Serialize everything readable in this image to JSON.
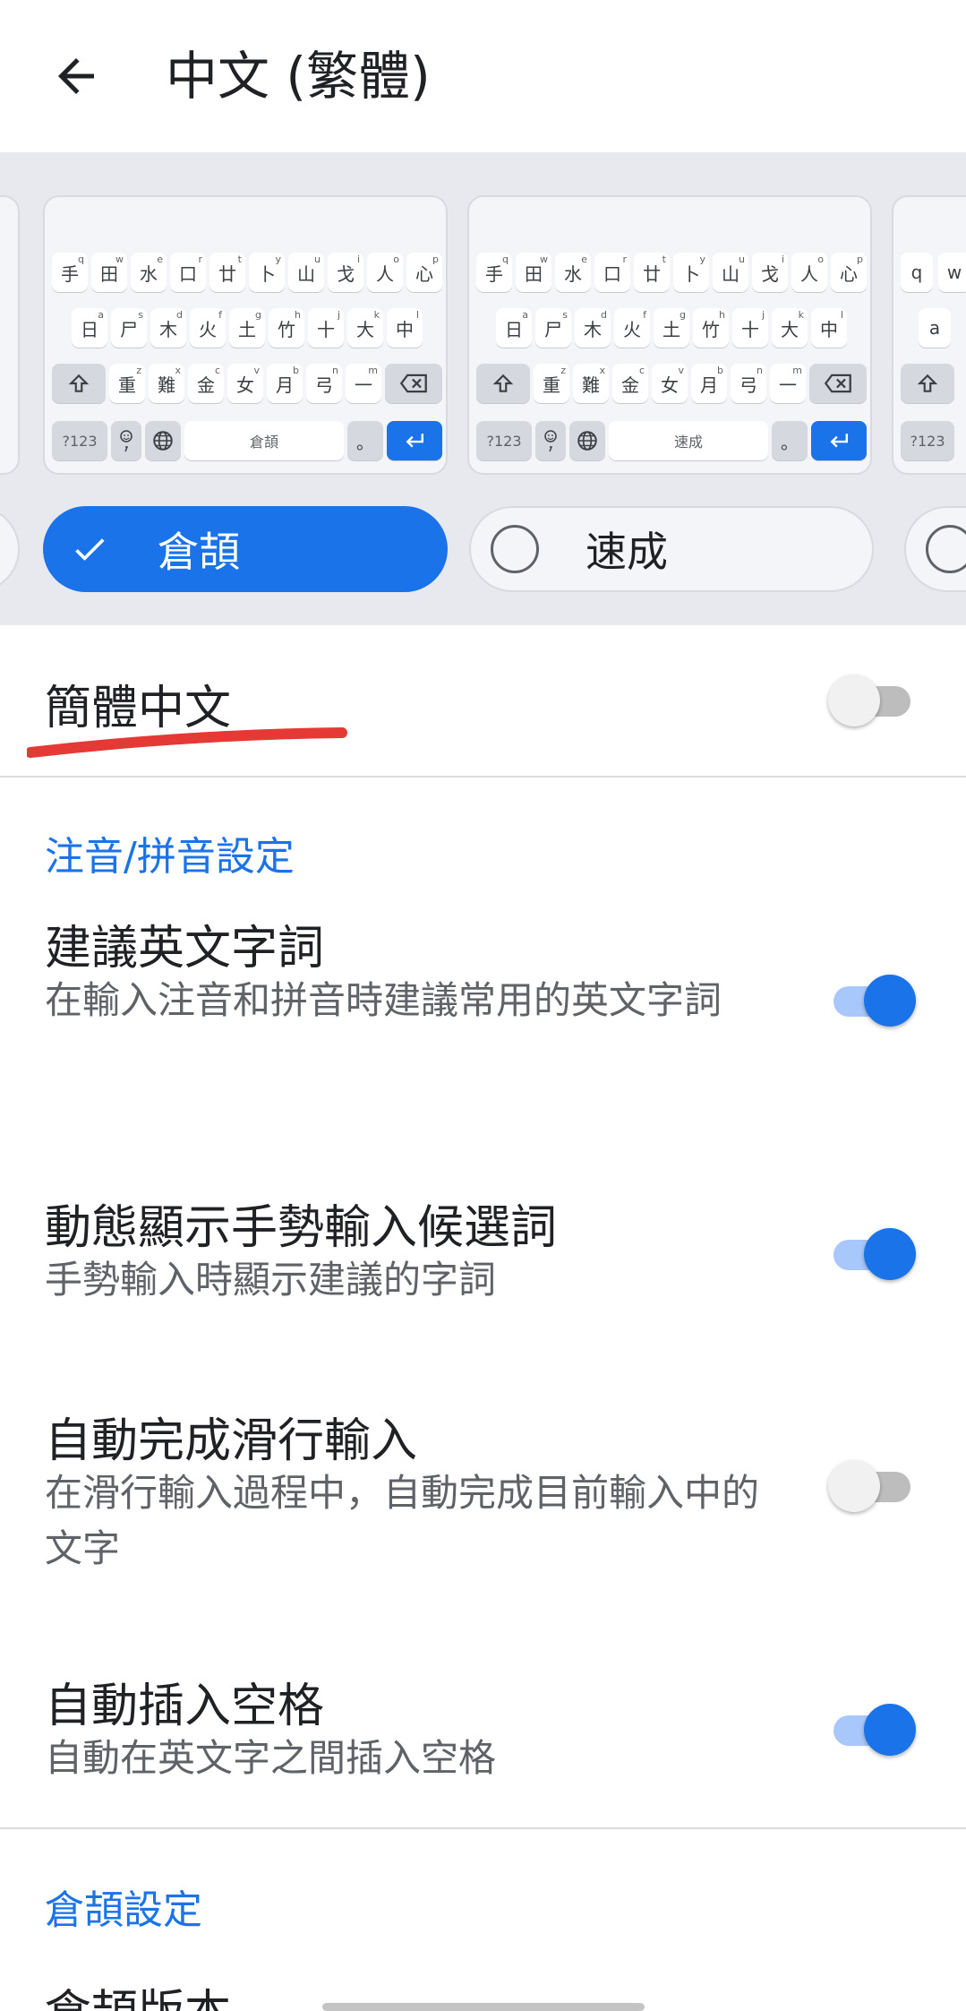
{
  "header": {
    "title": "中文 (繁體)"
  },
  "layouts": {
    "cards": [
      {
        "rows": [
          [
            [
              "手",
              "q"
            ],
            [
              "田",
              "w"
            ],
            [
              "水",
              "e"
            ],
            [
              "口",
              "r"
            ],
            [
              "廿",
              "t"
            ],
            [
              "卜",
              "y"
            ],
            [
              "山",
              "u"
            ],
            [
              "戈",
              "i"
            ],
            [
              "人",
              "o"
            ],
            [
              "心",
              "p"
            ]
          ],
          [
            [
              "日",
              "a"
            ],
            [
              "尸",
              "s"
            ],
            [
              "木",
              "d"
            ],
            [
              "火",
              "f"
            ],
            [
              "土",
              "g"
            ],
            [
              "竹",
              "h"
            ],
            [
              "十",
              "j"
            ],
            [
              "大",
              "k"
            ],
            [
              "中",
              "l"
            ]
          ],
          [
            [
              "重",
              "z"
            ],
            [
              "難",
              "x"
            ],
            [
              "金",
              "c"
            ],
            [
              "女",
              "v"
            ],
            [
              "月",
              "b"
            ],
            [
              "弓",
              "n"
            ],
            [
              "一",
              "m"
            ]
          ]
        ],
        "symbols_key": "?123",
        "space_label": "倉頡",
        "period": "。"
      },
      {
        "rows": [
          [
            [
              "手",
              "q"
            ],
            [
              "田",
              "w"
            ],
            [
              "水",
              "e"
            ],
            [
              "口",
              "r"
            ],
            [
              "廿",
              "t"
            ],
            [
              "卜",
              "y"
            ],
            [
              "山",
              "u"
            ],
            [
              "戈",
              "i"
            ],
            [
              "人",
              "o"
            ],
            [
              "心",
              "p"
            ]
          ],
          [
            [
              "日",
              "a"
            ],
            [
              "尸",
              "s"
            ],
            [
              "木",
              "d"
            ],
            [
              "火",
              "f"
            ],
            [
              "土",
              "g"
            ],
            [
              "竹",
              "h"
            ],
            [
              "十",
              "j"
            ],
            [
              "大",
              "k"
            ],
            [
              "中",
              "l"
            ]
          ],
          [
            [
              "重",
              "z"
            ],
            [
              "難",
              "x"
            ],
            [
              "金",
              "c"
            ],
            [
              "女",
              "v"
            ],
            [
              "月",
              "b"
            ],
            [
              "弓",
              "n"
            ],
            [
              "一",
              "m"
            ]
          ]
        ],
        "symbols_key": "?123",
        "space_label": "速成",
        "period": "。"
      }
    ],
    "partial_right": {
      "row1": [
        "q",
        "w"
      ],
      "row2": [
        "a"
      ],
      "symbols_key": "?123"
    },
    "chips": [
      {
        "label": "倉頡",
        "selected": true
      },
      {
        "label": "速成",
        "selected": false
      }
    ]
  },
  "settings": {
    "simplified": {
      "title": "簡體中文",
      "enabled": false
    },
    "section_zhuyin": "注音/拼音設定",
    "suggest_english": {
      "title": "建議英文字詞",
      "subtitle": "在輸入注音和拼音時建議常用的英文字詞",
      "enabled": true
    },
    "gesture_candidates": {
      "title": "動態顯示手勢輸入候選詞",
      "subtitle": "手勢輸入時顯示建議的字詞",
      "enabled": true
    },
    "auto_complete_swipe": {
      "title": "自動完成滑行輸入",
      "subtitle": "在滑行輸入過程中，自動完成目前輸入中的文字",
      "enabled": false
    },
    "auto_space": {
      "title": "自動插入空格",
      "subtitle": "自動在英文字之間插入空格",
      "enabled": true
    },
    "section_cangjie": "倉頡設定",
    "cangjie_version": {
      "title": "倉頡版本"
    }
  },
  "colors": {
    "accent": "#1a73e8",
    "annotation": "#e53935"
  }
}
